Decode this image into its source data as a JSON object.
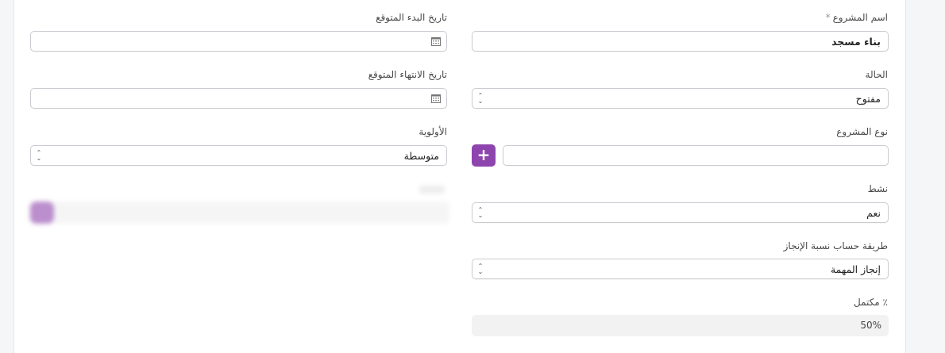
{
  "form": {
    "project_name": {
      "label": "اسم المشروع",
      "required_mark": "*",
      "value": "بناء مسجد"
    },
    "start_date": {
      "label": "تاريخ البدء المتوقع",
      "value": ""
    },
    "status": {
      "label": "الحالة",
      "value": "مفتوح"
    },
    "end_date": {
      "label": "تاريخ الانتهاء المتوقع",
      "value": ""
    },
    "project_type": {
      "label": "نوع المشروع",
      "value": ""
    },
    "priority": {
      "label": "الأولوية",
      "value": "متوسطة"
    },
    "active": {
      "label": "نشط",
      "value": "نعم"
    },
    "completion_method": {
      "label": "طريقة حساب نسبة الإنجاز",
      "value": "إنجاز المهمة"
    },
    "percent_complete": {
      "label": "٪ مكتمل",
      "value": "50%"
    }
  },
  "colors": {
    "accent": "#8e44ad",
    "border": "#c9ccd1"
  },
  "icons": {
    "calendar": "calendar-icon",
    "select": "select-arrows-icon",
    "add": "plus-icon"
  }
}
